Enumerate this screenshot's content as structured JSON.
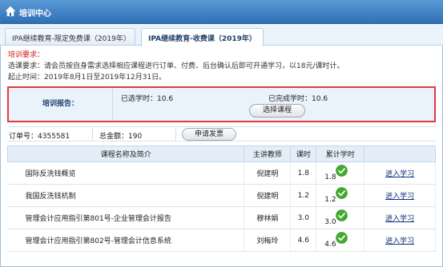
{
  "header": {
    "title": "培训中心"
  },
  "tabs": [
    {
      "label": "IPA继续教育-限定免费课（2019年）"
    },
    {
      "label": "IPA继续教育-收费课（2019年）"
    }
  ],
  "requirements": {
    "title": "培训要求：",
    "line1": "选课要求：请会员按自身需求选择相应课程进行订单、付费、后台确认后即可开通学习，以18元/课时计。",
    "line2": "起止时间：2019年8月1日至2019年12月31日。"
  },
  "report": {
    "label": "培训报告：",
    "selected_hours": "已选学时：10.6",
    "completed_hours": "已完成学时：10.6",
    "choose_button": "选择课程"
  },
  "order": {
    "order_no": "订单号：4355581",
    "total": "总金额：190",
    "invoice_button": "申请发票"
  },
  "table": {
    "headers": [
      "课程名称及简介",
      "主讲教师",
      "课时",
      "累计学时",
      ""
    ],
    "rows": [
      {
        "name": "国际反洗钱概览",
        "teacher": "倪建明",
        "hours": "1.8",
        "done": "1.8",
        "action": "进入学习"
      },
      {
        "name": "我国反洗钱机制",
        "teacher": "倪建明",
        "hours": "1.2",
        "done": "1.2",
        "action": "进入学习"
      },
      {
        "name": "管理会计应用指引第801号-企业管理会计报告",
        "teacher": "穆林娟",
        "hours": "3.0",
        "done": "3.0",
        "action": "进入学习"
      },
      {
        "name": "管理会计应用指引第802号-管理会计信息系统",
        "teacher": "刘梅玲",
        "hours": "4.6",
        "done": "4.6",
        "action": "进入学习"
      }
    ]
  },
  "colors": {
    "header_blue": "#2f6fb5",
    "highlight_red": "#e03b3b",
    "check_green": "#3fae2a"
  },
  "icons": {
    "home": "home-icon",
    "check": "check-circle-icon"
  }
}
